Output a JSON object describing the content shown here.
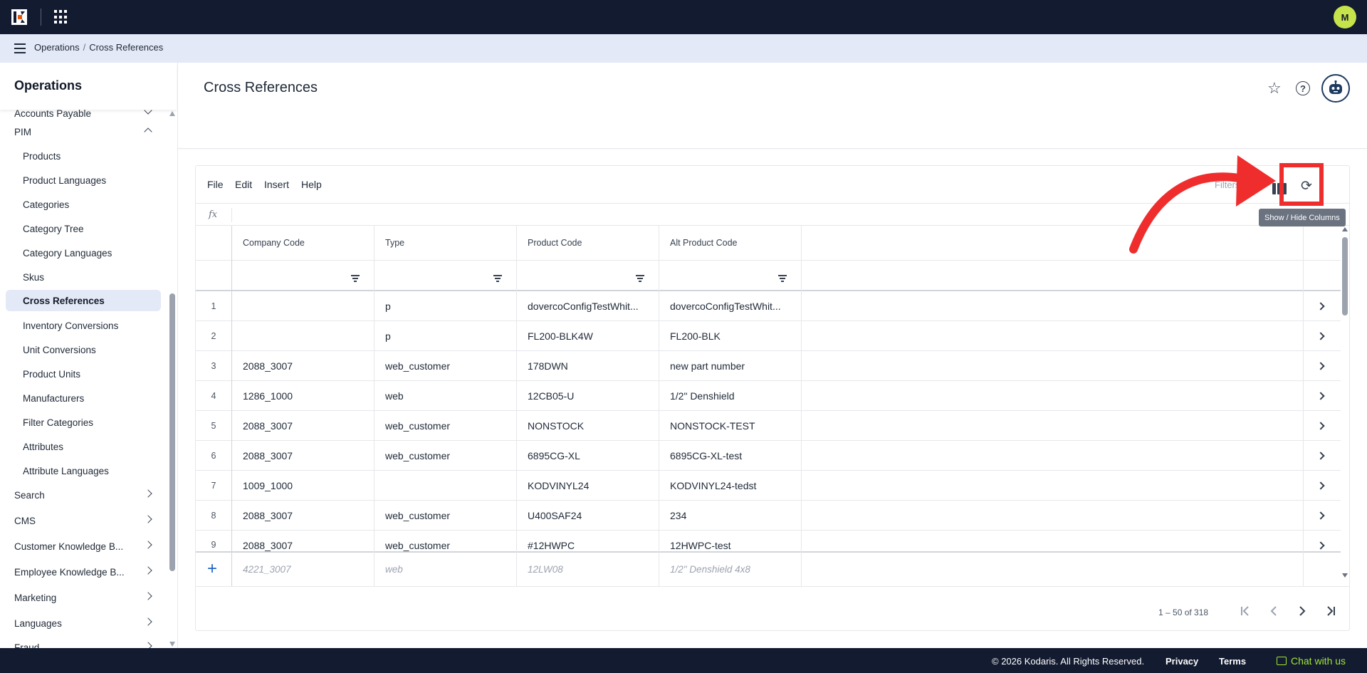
{
  "colors": {
    "topbar": "#121b30",
    "breadcrumb_bg": "#e4e9f7",
    "accent_avatar": "#c7e34b",
    "annotation_red": "#ef2d2d",
    "chat_green": "#a3e635"
  },
  "topbar": {
    "logo_icon": "kodaris-logo-icon",
    "apps_icon": "apps-grid-icon",
    "user_initial": "M"
  },
  "breadcrumb": {
    "items": [
      "Operations",
      "Cross References"
    ],
    "separator": "/"
  },
  "sidebar": {
    "title": "Operations",
    "partial_top": "Accounts Payable",
    "section": "PIM",
    "items": [
      {
        "label": "Products"
      },
      {
        "label": "Product Languages"
      },
      {
        "label": "Categories"
      },
      {
        "label": "Category Tree"
      },
      {
        "label": "Category Languages"
      },
      {
        "label": "Skus"
      },
      {
        "label": "Cross References",
        "active": true
      },
      {
        "label": "Inventory Conversions"
      },
      {
        "label": "Unit Conversions"
      },
      {
        "label": "Product Units"
      },
      {
        "label": "Manufacturers"
      },
      {
        "label": "Filter Categories"
      },
      {
        "label": "Attributes"
      },
      {
        "label": "Attribute Languages"
      }
    ],
    "groups": [
      {
        "label": "Search"
      },
      {
        "label": "CMS"
      },
      {
        "label": "Customer Knowledge B..."
      },
      {
        "label": "Employee Knowledge B..."
      },
      {
        "label": "Marketing"
      },
      {
        "label": "Languages"
      },
      {
        "label": "Fraud"
      }
    ]
  },
  "page": {
    "title": "Cross References",
    "icons": [
      "star-icon",
      "help-icon",
      "assistant-bot-icon"
    ]
  },
  "toolbar": {
    "menus": [
      "File",
      "Edit",
      "Insert",
      "Help"
    ],
    "hidden_label": "Filters",
    "columns_tooltip": "Show / Hide Columns",
    "formula_label": "fx"
  },
  "grid": {
    "columns": [
      "Company Code",
      "Type",
      "Product Code",
      "Alt Product Code"
    ],
    "rows": [
      {
        "n": "1",
        "company": "",
        "type": "p",
        "product": "dovercoConfigTestWhit...",
        "alt": "dovercoConfigTestWhit..."
      },
      {
        "n": "2",
        "company": "",
        "type": "p",
        "product": "FL200-BLK4W",
        "alt": "FL200-BLK"
      },
      {
        "n": "3",
        "company": "2088_3007",
        "type": "web_customer",
        "product": "178DWN",
        "alt": "new part number"
      },
      {
        "n": "4",
        "company": "1286_1000",
        "type": "web",
        "product": "12CB05-U",
        "alt": "1/2\" Denshield"
      },
      {
        "n": "5",
        "company": "2088_3007",
        "type": "web_customer",
        "product": "NONSTOCK",
        "alt": "NONSTOCK-TEST"
      },
      {
        "n": "6",
        "company": "2088_3007",
        "type": "web_customer",
        "product": "6895CG-XL",
        "alt": "6895CG-XL-test"
      },
      {
        "n": "7",
        "company": "1009_1000",
        "type": "",
        "product": "KODVINYL24",
        "alt": "KODVINYL24-tedst"
      },
      {
        "n": "8",
        "company": "2088_3007",
        "type": "web_customer",
        "product": "U400SAF24",
        "alt": "234"
      },
      {
        "n": "9",
        "company": "2088_3007",
        "type": "web_customer",
        "product": "#12HWPC",
        "alt": "12HWPC-test"
      }
    ],
    "new_row_placeholder": {
      "company": "4221_3007",
      "type": "web",
      "product": "12LW08",
      "alt": "1/2\" Denshield 4x8"
    }
  },
  "pager": {
    "range": "1 – 50 of 318"
  },
  "footer": {
    "copyright": "© 2026 Kodaris. All Rights Reserved.",
    "privacy": "Privacy",
    "terms": "Terms",
    "chat": "Chat with us"
  }
}
